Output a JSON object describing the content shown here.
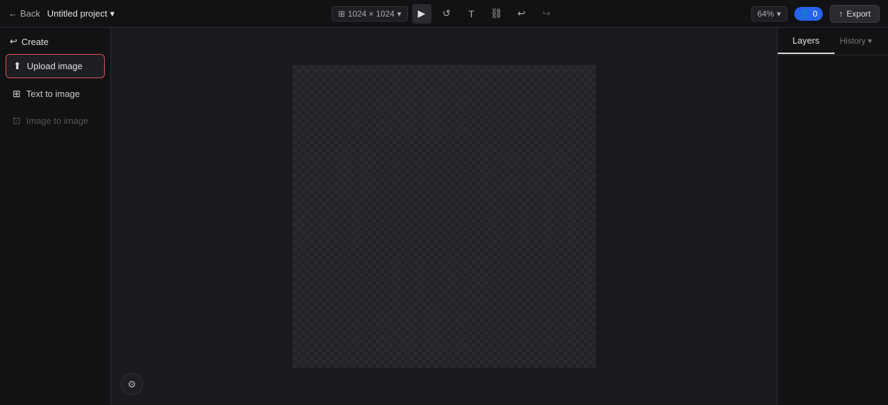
{
  "topbar": {
    "back_label": "Back",
    "project_title": "Untitled project",
    "canvas_size": "1024 × 1024",
    "zoom_level": "64%",
    "user_count": "0",
    "export_label": "Export"
  },
  "sidebar": {
    "create_label": "Create",
    "items": [
      {
        "id": "upload-image",
        "label": "Upload image",
        "icon": "⬆",
        "state": "active"
      },
      {
        "id": "text-to-image",
        "label": "Text to image",
        "icon": "⊞",
        "state": "normal"
      },
      {
        "id": "image-to-image",
        "label": "Image to image",
        "icon": "⊡",
        "state": "disabled"
      }
    ]
  },
  "right_sidebar": {
    "tabs": [
      {
        "id": "layers",
        "label": "Layers",
        "active": true
      },
      {
        "id": "history",
        "label": "History",
        "active": false
      }
    ]
  },
  "toolbar": {
    "icons": [
      {
        "id": "play",
        "symbol": "▶",
        "active": true
      },
      {
        "id": "rotate",
        "symbol": "↺",
        "active": false
      },
      {
        "id": "text",
        "symbol": "T",
        "active": false
      },
      {
        "id": "link",
        "symbol": "🔗",
        "active": false
      },
      {
        "id": "undo",
        "symbol": "↩",
        "active": false
      },
      {
        "id": "redo",
        "symbol": "↪",
        "active": false,
        "disabled": true
      }
    ]
  },
  "settings_btn_icon": "⚙"
}
